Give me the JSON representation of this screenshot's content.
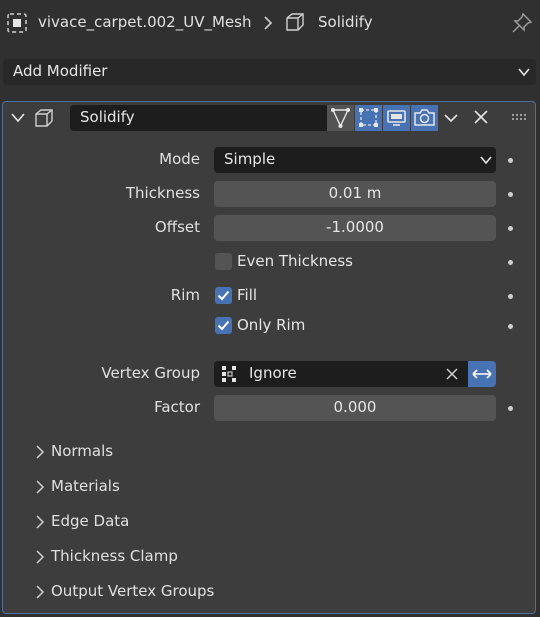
{
  "header": {
    "object_name": "vivace_carpet.002_UV_Mesh",
    "modifier_name": "Solidify"
  },
  "add_modifier": {
    "label": "Add Modifier"
  },
  "modifier": {
    "name": "Solidify",
    "mode": {
      "label": "Mode",
      "value": "Simple"
    },
    "thickness": {
      "label": "Thickness",
      "value": "0.01 m"
    },
    "offset": {
      "label": "Offset",
      "value": "-1.0000"
    },
    "even_thickness": {
      "label": "Even Thickness",
      "checked": false
    },
    "rim": {
      "label": "Rim"
    },
    "fill": {
      "label": "Fill",
      "checked": true
    },
    "only_rim": {
      "label": "Only Rim",
      "checked": true
    },
    "vertex_group": {
      "label": "Vertex Group",
      "value": "Ignore"
    },
    "factor": {
      "label": "Factor",
      "value": "0.000"
    }
  },
  "subpanels": [
    "Normals",
    "Materials",
    "Edge Data",
    "Thickness Clamp",
    "Output Vertex Groups"
  ],
  "colors": {
    "accent": "#4772b3",
    "panel": "#3d3d3d",
    "background": "#303030"
  }
}
